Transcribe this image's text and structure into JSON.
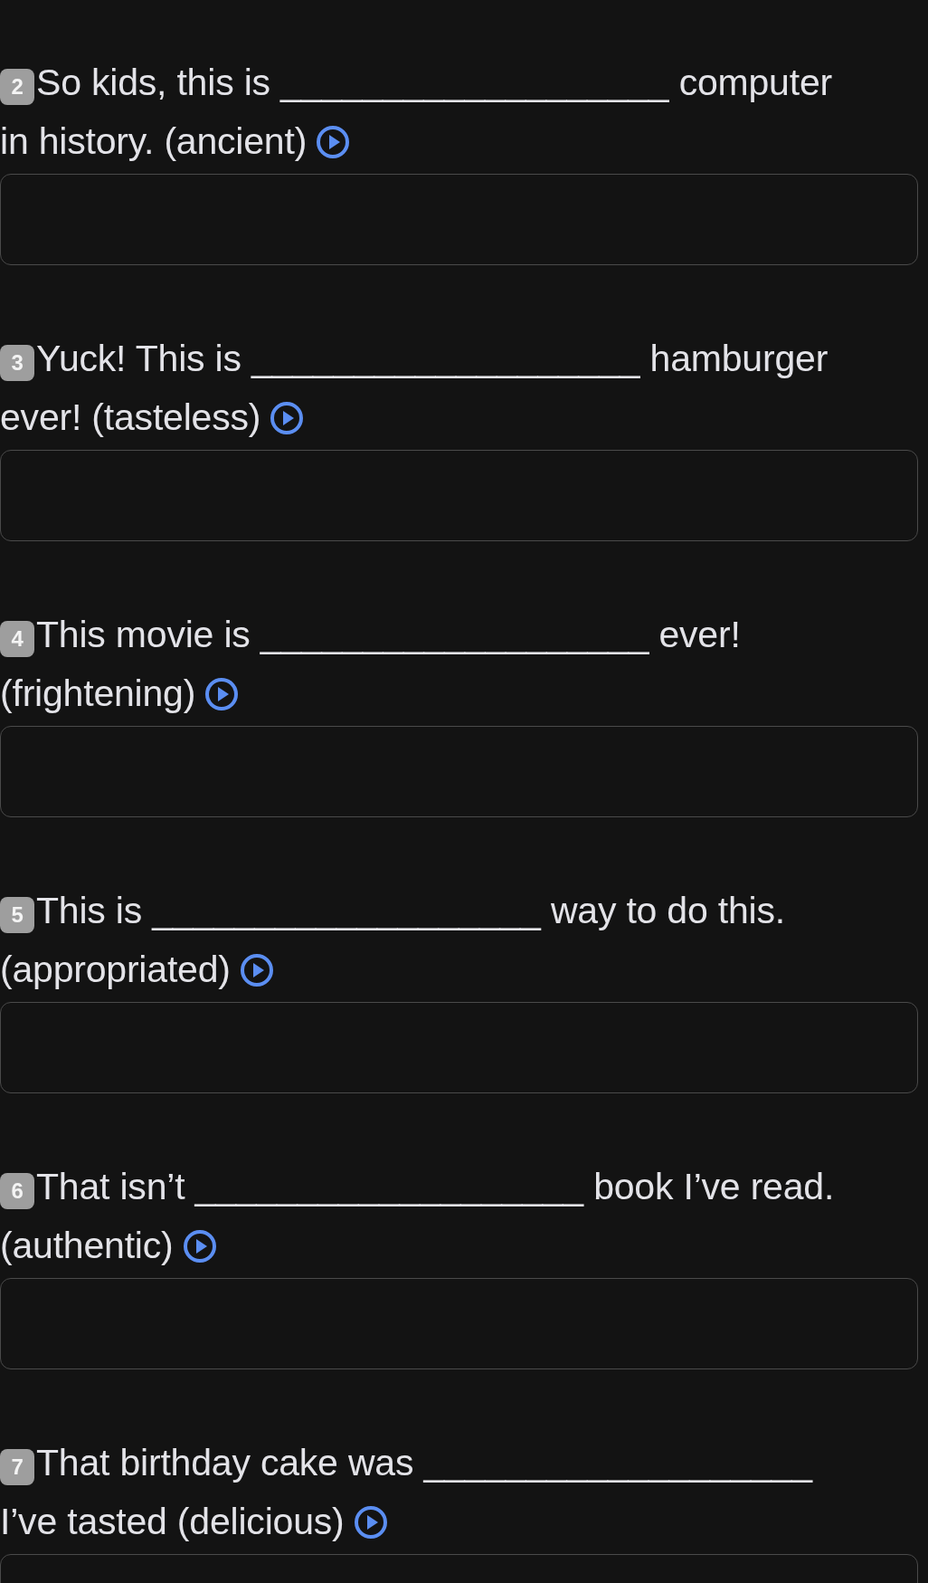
{
  "questions": [
    {
      "number": "2",
      "lines": [
        "So kids, this is ___________________ computer",
        "in history. (ancient)"
      ]
    },
    {
      "number": "3",
      "lines": [
        "Yuck! This is ___________________ hamburger",
        "ever! (tasteless)"
      ]
    },
    {
      "number": "4",
      "lines": [
        "This movie is ___________________ ever!",
        "(frightening)"
      ]
    },
    {
      "number": "5",
      "lines": [
        "This is ___________________ way to do this.",
        "(appropriated)"
      ]
    },
    {
      "number": "6",
      "lines": [
        "That isn’t ___________________ book I’ve read.",
        "(authentic)"
      ]
    },
    {
      "number": "7",
      "lines": [
        "That birthday cake was ___________________",
        "I’ve tasted (delicious)"
      ]
    }
  ]
}
